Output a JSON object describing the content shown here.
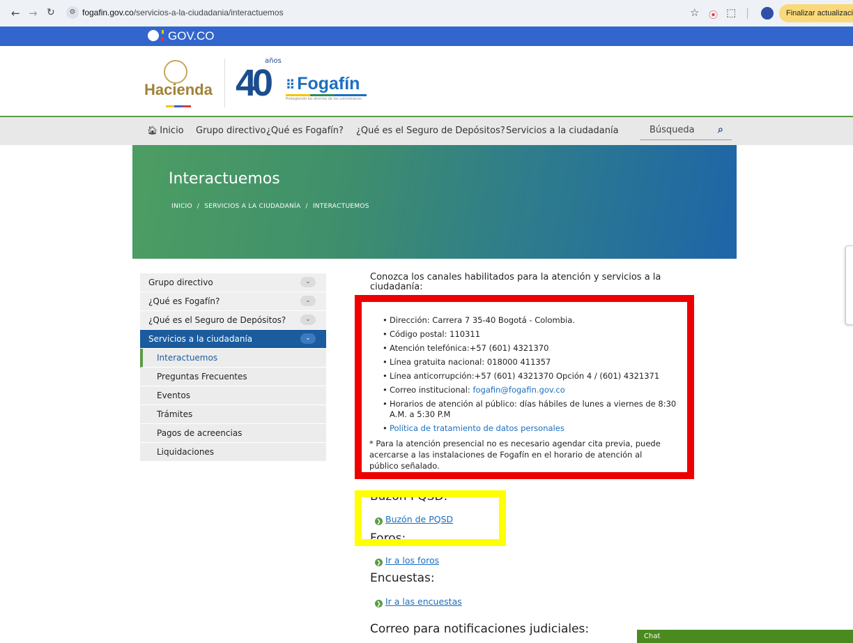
{
  "browser": {
    "url_host": "fogafin.gov.co",
    "url_path": "/servicios-a-la-ciudadania/interactuemos",
    "update_button": "Finalizar actualización"
  },
  "govbar": {
    "label": "GOV.CO"
  },
  "logos": {
    "hacienda": "Hacienda",
    "forty": "40",
    "anos": "años",
    "fogafin": "Fogafín",
    "fogafin_tagline": "Protegiendo los ahorros de los colombianos"
  },
  "nav": {
    "items": [
      "Inicio",
      "Grupo directivo",
      "¿Qué es Fogafín?",
      "¿Qué es el Seguro de Depósitos?",
      "Servicios a la ciudadanía"
    ],
    "search_placeholder": "Búsqueda"
  },
  "hero": {
    "title": "Interactuemos",
    "breadcrumb": [
      "INICIO",
      "SERVICIOS A LA CIUDADANÍA",
      "INTERACTUEMOS"
    ],
    "separator": "/"
  },
  "sidebar": {
    "items": [
      {
        "label": "Grupo directivo"
      },
      {
        "label": "¿Qué es Fogafín?"
      },
      {
        "label": "¿Qué es el Seguro de Depósitos?"
      },
      {
        "label": "Servicios a la ciudadanía"
      }
    ],
    "subitems": [
      "Interactuemos",
      "Preguntas Frecuentes",
      "Eventos",
      "Trámites",
      "Pagos de acreencias",
      "Liquidaciones"
    ]
  },
  "content": {
    "intro": "Conozca los canales habilitados para la atención y servicios a la ciudadanía:",
    "channels": [
      "Dirección: Carrera 7 35-40 Bogotá - Colombia.",
      "Código postal: 110311",
      "Atención telefónica:+57 (601) 4321370",
      "Línea gratuita nacional: 018000 411357",
      "Línea anticorrupción:+57 (601) 4321370 Opción 4 / (601) 4321371"
    ],
    "email_label": "Correo institucional: ",
    "email": "fogafin@fogafin.gov.co",
    "hours": "Horarios de atención al público: días hábiles de lunes a viernes de 8:30 A.M. a 5:30 P.M",
    "privacy_link": "Política de tratamiento de datos personales",
    "note": "* Para la atención presencial no es necesario agendar cita previa, puede acercarse a las instalaciones de Fogafín en el horario de atención al público señalado.",
    "pqsd_title": "Buzón PQSD:",
    "pqsd_link": "Buzón de PQSD",
    "foros_title": "Foros:",
    "foros_link": "Ir a los foros",
    "encuestas_title": "Encuestas:",
    "encuestas_link": "Ir a las encuestas",
    "notif_title": "Correo para notificaciones judiciales:"
  },
  "chat": {
    "label": "Chat"
  },
  "colors": {
    "gov_blue": "#3366cc",
    "accent_green": "#5b9b43",
    "active_blue": "#1a5c9e",
    "link_blue": "#1b6fc0",
    "annotation_red": "#ee0000",
    "annotation_yellow": "#ffff00"
  }
}
